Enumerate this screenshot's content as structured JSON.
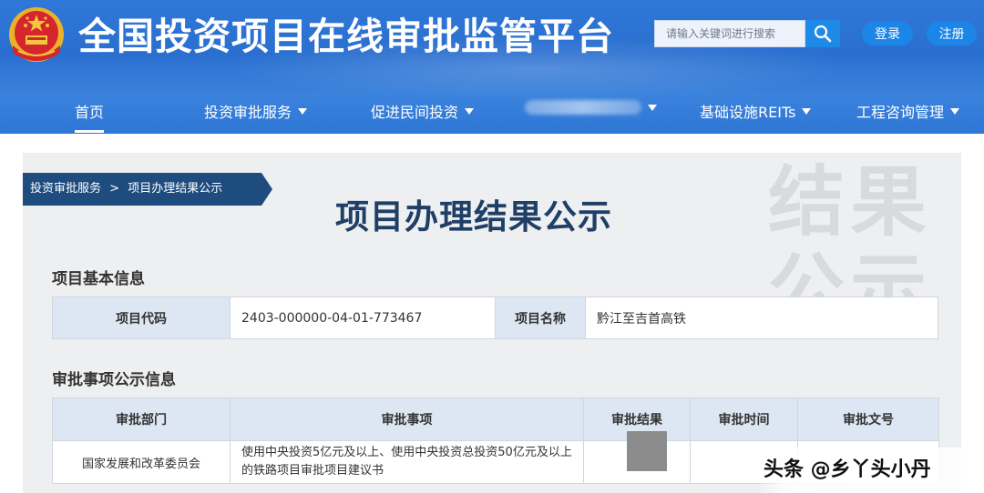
{
  "header": {
    "site_title": "全国投资项目在线审批监管平台",
    "search_placeholder": "请输入关键词进行搜索",
    "login_label": "登录",
    "register_label": "注册",
    "brand_color": "#2f78d8"
  },
  "nav": {
    "items": [
      {
        "label": "首页",
        "active": true
      },
      {
        "label": "投资审批服务",
        "dropdown": true
      },
      {
        "label": "促进民间投资",
        "dropdown": true
      },
      {
        "label": "",
        "dropdown": true
      },
      {
        "label": "基础设施REITs",
        "dropdown": true
      },
      {
        "label": "工程咨询管理",
        "dropdown": true
      }
    ]
  },
  "breadcrumb": {
    "parent": "投资审批服务",
    "separator": ">",
    "current": "项目办理结果公示"
  },
  "watermark": {
    "line1": "结果",
    "line2": "公示"
  },
  "page_title": "项目办理结果公示",
  "basic_info": {
    "section_title": "项目基本信息",
    "code_label": "项目代码",
    "code_value": "2403-000000-04-01-773467",
    "name_label": "项目名称",
    "name_value": "黔江至吉首高铁"
  },
  "approval": {
    "section_title": "审批事项公示信息",
    "columns": [
      "审批部门",
      "审批事项",
      "审批结果",
      "审批时间",
      "审批文号"
    ],
    "rows": [
      {
        "department": "国家发展和改革委员会",
        "item": "使用中央投资5亿元及以上、使用中央投资总投资50亿元及以上的铁路项目审批项目建议书",
        "result": "",
        "time": "",
        "doc_no": ""
      }
    ]
  },
  "signature": "头条 @乡丫头小丹"
}
